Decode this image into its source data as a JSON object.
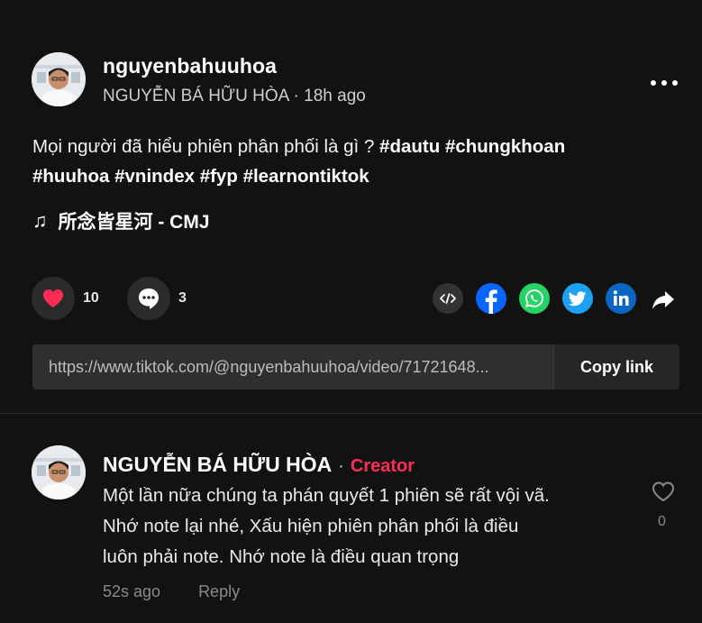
{
  "post": {
    "username": "nguyenbahuuhoa",
    "display_name": "NGUYỄN BÁ HỮU HÒA",
    "separator": " · ",
    "time": "18h ago",
    "caption_line1_text": "Mọi người đã hiểu phiên phân phối là gì ? ",
    "caption_line1_tags": [
      "#dautu",
      "#chungkhoan"
    ],
    "caption_line2_tags": [
      "#huuhoa",
      "#vnindex",
      "#fyp",
      "#learnontiktok"
    ],
    "music_note": "♫",
    "music": "所念皆星河 - CMJ",
    "more_icon": "more-dots-icon"
  },
  "actions": {
    "likes": "10",
    "comments": "3",
    "like_icon": "heart-icon",
    "comment_icon": "comment-bubble-icon"
  },
  "share": {
    "icons": [
      "embed-icon",
      "facebook-icon",
      "whatsapp-icon",
      "twitter-icon",
      "linkedin-icon",
      "share-arrow-icon"
    ],
    "colors": {
      "embed": "#333333",
      "facebook": "#0866ff",
      "whatsapp": "#25d366",
      "twitter": "#1da1f2",
      "linkedin": "#0a66c2"
    }
  },
  "link": {
    "url": "https://www.tiktok.com/@nguyenbahuuhoa/video/71721648...",
    "copy_label": "Copy link"
  },
  "comment": {
    "author": "NGUYỄN BÁ HỮU HÒA",
    "dot": "·",
    "badge": "Creator",
    "badge_color": "#fe2c55",
    "lines": [
      "Một lần nữa chúng ta phán quyết 1 phiên sẽ rất vội vã.",
      "Nhớ note lại nhé, Xấu hiện phiên phân phối là điều",
      "luôn phải note. Nhớ note là điều quan trọng"
    ],
    "time": "52s ago",
    "reply_label": "Reply",
    "like_count": "0"
  }
}
